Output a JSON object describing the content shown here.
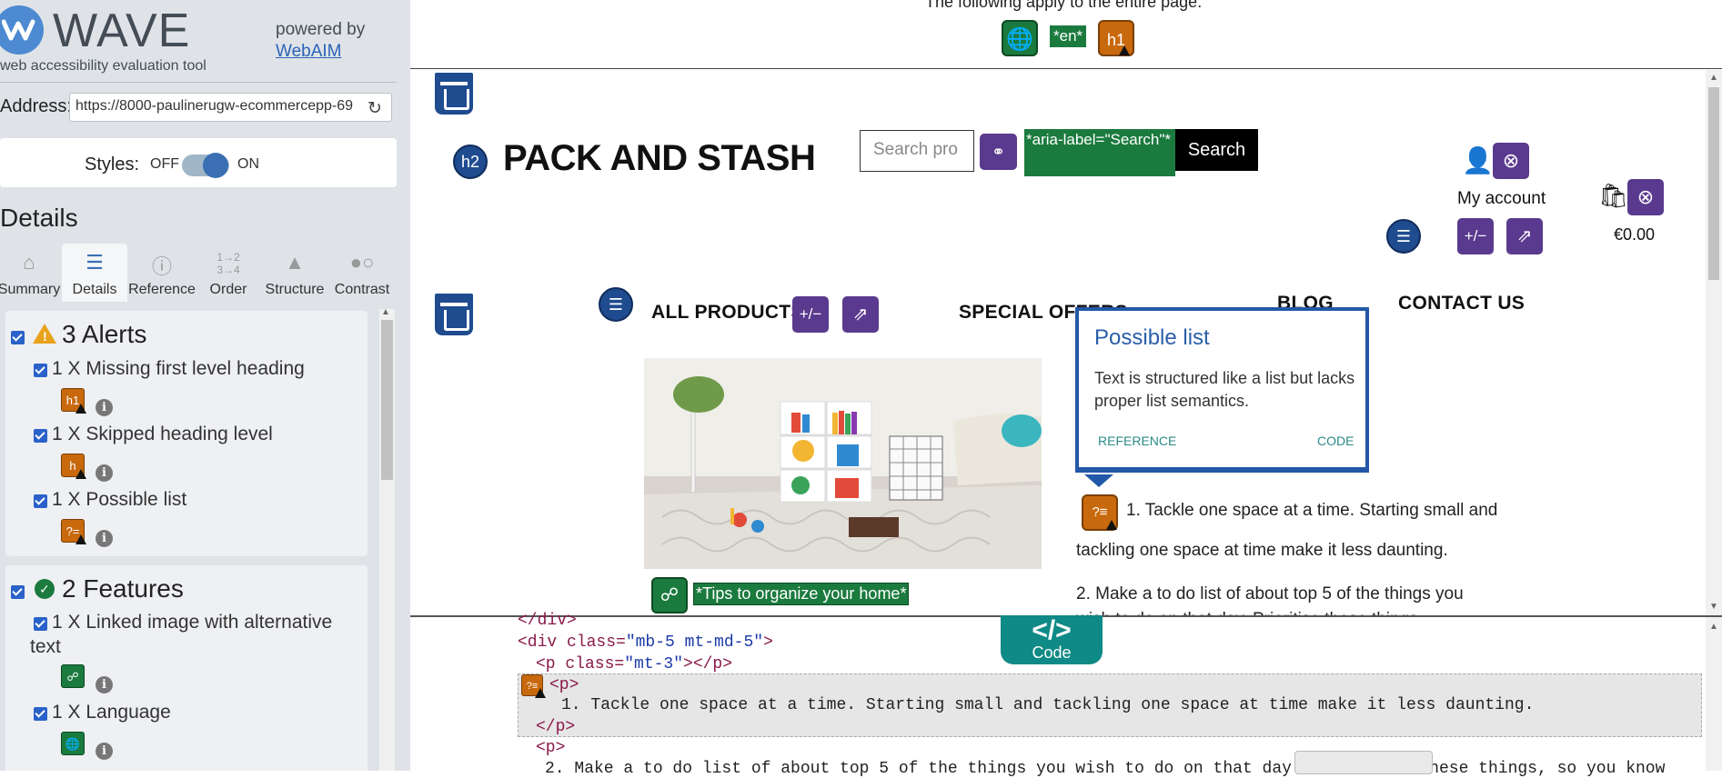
{
  "panel": {
    "logo_text": "WAVE",
    "logo_sub": "web accessibility evaluation tool",
    "powered_by": "powered by",
    "webaim_link": "WebAIM",
    "address_label": "Address:",
    "address_value": "https://8000-paulinerugw-ecommercepp-69",
    "styles_label": "Styles:",
    "styles_off": "OFF",
    "styles_on": "ON",
    "details_title": "Details",
    "tabs": [
      {
        "label": "Summary",
        "icon": "home-icon"
      },
      {
        "label": "Details",
        "icon": "list-icon"
      },
      {
        "label": "Reference",
        "icon": "info-icon"
      },
      {
        "label": "Order",
        "icon": "order-icon"
      },
      {
        "label": "Structure",
        "icon": "structure-icon"
      },
      {
        "label": "Contrast",
        "icon": "contrast-icon"
      }
    ],
    "alerts": {
      "title": "3 Alerts",
      "items": [
        {
          "text": "1 X Missing first level heading",
          "icon_label": "h1"
        },
        {
          "text": "1 X Skipped heading level",
          "icon_label": "h"
        },
        {
          "text": "1 X Possible list",
          "icon_label": "?="
        }
      ]
    },
    "features": {
      "title": "2 Features",
      "items": [
        {
          "text_line1": "1 X Linked image with alternative",
          "text_line2": "text"
        },
        {
          "text_line1": "1 X Language"
        }
      ]
    }
  },
  "page_top": {
    "applies_text": "The following apply to the entire page:",
    "lang_badge": "*en*",
    "h1_icon": "h1"
  },
  "site": {
    "h2_icon": "h2",
    "brand": "PACK AND STASH",
    "search_placeholder": "Search pro",
    "aria_badge": "*aria-label=\"Search\"*",
    "search_button": "Search",
    "my_account": "My account",
    "price": "€0.00",
    "nav": {
      "all_products": "ALL PRODUCTS",
      "special_offers": "SPECIAL OFFERS",
      "blog": "BLOG",
      "contact": "CONTACT US"
    },
    "tips_badge": "*Tips to organize your home*",
    "popup": {
      "title": "Possible list",
      "desc": "Text is structured like a list but lacks proper list semantics.",
      "reference": "REFERENCE",
      "code": "CODE"
    },
    "tip1_line1": "1. Tackle one space at a time. Starting small and",
    "tip1_line2": "tackling one space at time make it less daunting.",
    "tip2_line1": "2. Make a to do list of about top 5 of the things you",
    "tip2_line2": "wish to do on that day. Prioritise these things"
  },
  "code": {
    "tab_label": "Code",
    "line0": "</div>",
    "line1_tag": "<div ",
    "line1_attr": "class=",
    "line1_str": "\"mb-5 mt-md-5\"",
    "line1_end": ">",
    "line2_tag": "<p ",
    "line2_attr": "class=",
    "line2_str": "\"mt-3\"",
    "line2_end": "></p>",
    "line3": "<p>",
    "line4": "1. Tackle one space at a time. Starting small and tackling one space at time make it less daunting.",
    "line5": "</p>",
    "line6": "<p>",
    "line7": "2. Make a to do list of about top 5 of the things you wish to do on that day. Prioritise these things, so you know"
  },
  "colors": {
    "wave_blue": "#4d8ad1",
    "alert_orange": "#c8690d",
    "feature_green": "#1b7a3e",
    "structure_navy": "#1f4b8f",
    "aria_purple": "#5a3a8e",
    "code_teal": "#0f8a86",
    "popup_blue": "#2358a8"
  }
}
